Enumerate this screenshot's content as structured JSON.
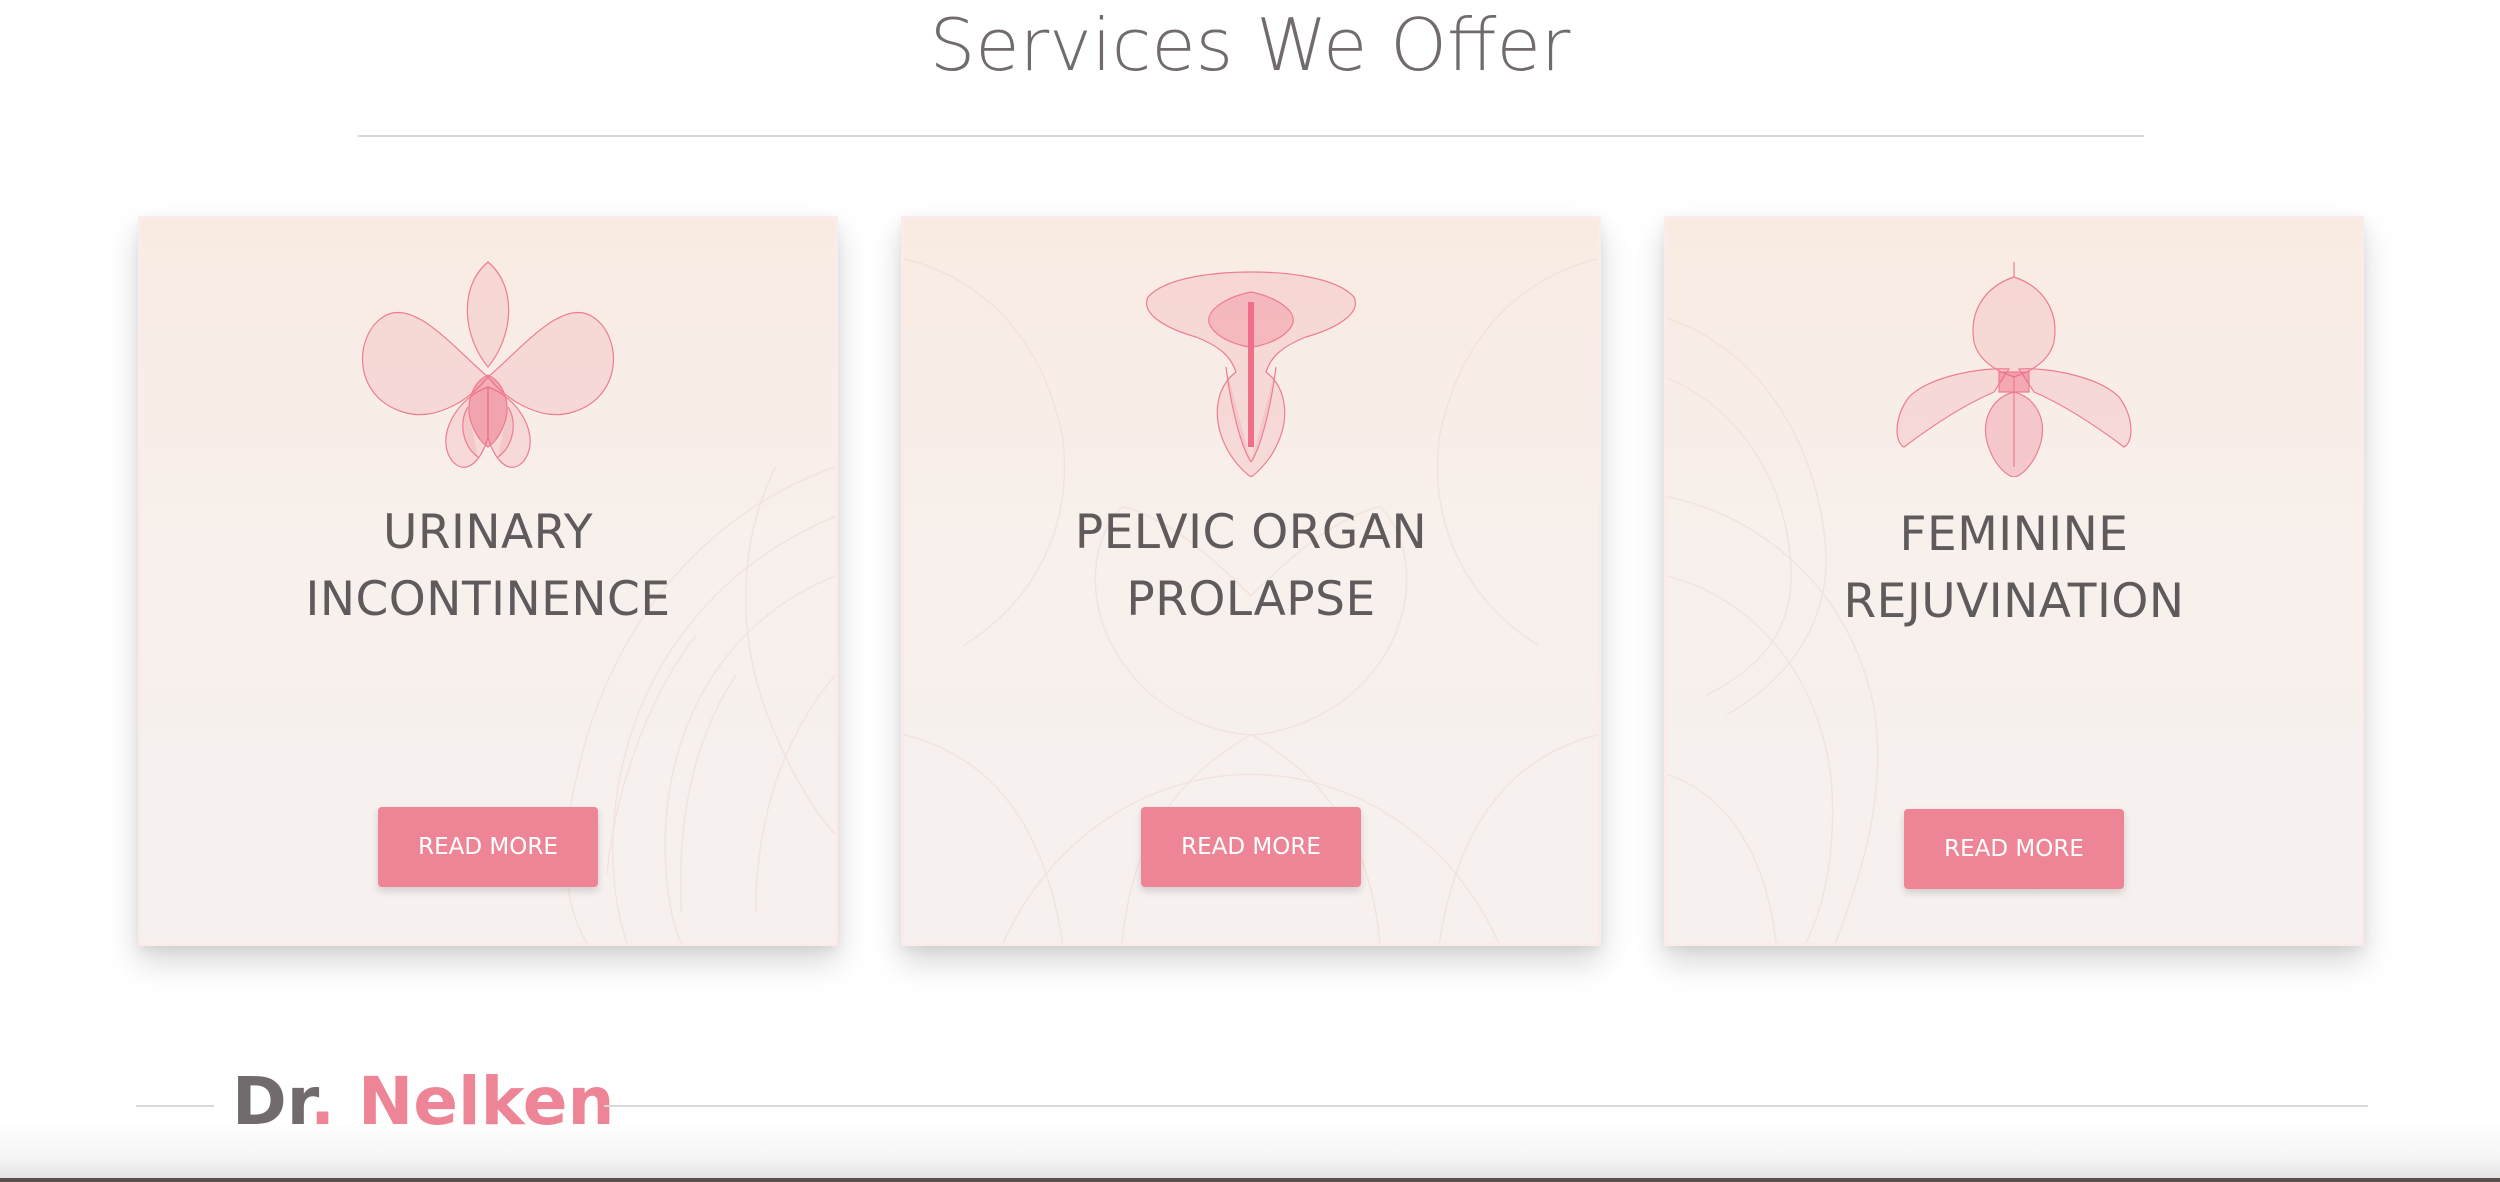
{
  "section": {
    "title": "Services We Offer"
  },
  "services": [
    {
      "title_line1": "URINARY",
      "title_line2": "INCONTINENCE",
      "button_label": "READ MORE",
      "icon": "orchid-flower-icon"
    },
    {
      "title_line1": "PELVIC ORGAN",
      "title_line2": "PROLAPSE",
      "button_label": "READ MORE",
      "icon": "calla-flower-icon"
    },
    {
      "title_line1": "FEMININE",
      "title_line2": "REJUVINATION",
      "button_label": "READ MORE",
      "icon": "slipper-orchid-icon"
    }
  ],
  "brand": {
    "prefix": "Dr",
    "dot": ".",
    "name": " Nelken"
  },
  "colors": {
    "accent": "#ee8596",
    "heading": "#716b6d",
    "card_text": "#5f5a5b",
    "card_bg_top": "#f9ebe2",
    "card_bg_bottom": "#f6f1ef",
    "divider": "#d9d9d9"
  }
}
